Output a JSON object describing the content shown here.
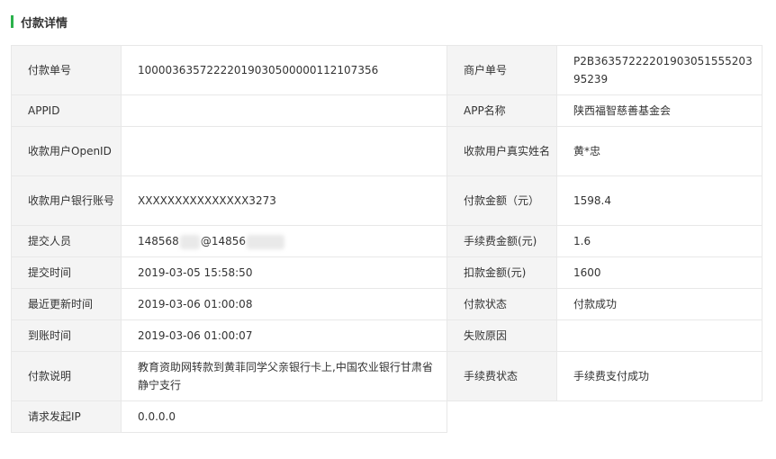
{
  "section": {
    "title": "付款详情"
  },
  "rows": [
    {
      "h": 55,
      "l1": "付款单号",
      "v1": "10000363572222019030500000112107356",
      "l2": "商户单号",
      "v2": "P2B3635722220190305155520395239"
    },
    {
      "h": 35,
      "l1": "APPID",
      "v1": "",
      "l2": "APP名称",
      "v2": "陕西福智慈善基金会"
    },
    {
      "h": 55,
      "l1": "收款用户OpenID",
      "v1": "",
      "l2": "收款用户真实姓名",
      "v2": "黄*忠"
    },
    {
      "h": 55,
      "l1": "收款用户银行账号",
      "v1": "XXXXXXXXXXXXXXX3273",
      "l2": "付款金额（元）",
      "v2": "1598.4"
    },
    {
      "h": 35,
      "l1": "提交人员",
      "v1a": "148568",
      "v1b": "@14856",
      "l2": "手续费金额(元)",
      "v2": "1.6"
    },
    {
      "h": 35,
      "l1": "提交时间",
      "v1": "2019-03-05 15:58:50",
      "l2": "扣款金额(元)",
      "v2": "1600"
    },
    {
      "h": 35,
      "l1": "最近更新时间",
      "v1": "2019-03-06 01:00:08",
      "l2": "付款状态",
      "v2": "付款成功"
    },
    {
      "h": 35,
      "l1": "到账时间",
      "v1": "2019-03-06 01:00:07",
      "l2": "失败原因",
      "v2": ""
    },
    {
      "h": 55,
      "l1": "付款说明",
      "v1": "教育资助网转款到黄菲同学父亲银行卡上,中国农业银行甘肃省静宁支行",
      "l2": "手续费状态",
      "v2": "手续费支付成功"
    },
    {
      "h": 35,
      "l1": "请求发起IP",
      "v1": "0.0.0.0"
    }
  ]
}
